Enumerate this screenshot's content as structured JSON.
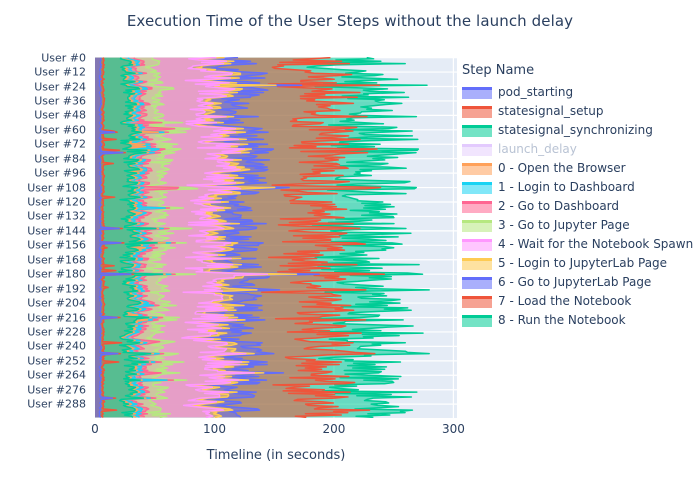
{
  "chart_data": {
    "type": "area",
    "title": "Execution Time of the User Steps without the launch delay",
    "xlabel": "Timeline (in seconds)",
    "ylabel": "",
    "xlim": [
      0,
      303
    ],
    "xticks": [
      0,
      100,
      200,
      300
    ],
    "xticklabels": [
      "0",
      "100",
      "200",
      "300"
    ],
    "grid": true,
    "orientation": "horizontal",
    "stacked": true,
    "legend_title": "Step Name",
    "legend_position": "right",
    "plot_bgcolor": "#e5ecf6",
    "paper_bgcolor": "#ffffff",
    "font_color": "#2a3f5f",
    "yticklabels": [
      "User #0",
      "User #12",
      "User #24",
      "User #36",
      "User #48",
      "User #60",
      "User #72",
      "User #84",
      "User #96",
      "User #108",
      "User #120",
      "User #132",
      "User #144",
      "User #156",
      "User #168",
      "User #180",
      "User #192",
      "User #204",
      "User #216",
      "User #228",
      "User #240",
      "User #252",
      "User #264",
      "User #276",
      "User #288"
    ],
    "ycategory_count": 300,
    "series": [
      {
        "name": "pod_starting",
        "line_color": "#636efa",
        "fill_color": "rgba(99,110,250,0.55)",
        "mean_value": 4.5,
        "visible": true
      },
      {
        "name": "statesignal_setup",
        "line_color": "#ef553b",
        "fill_color": "rgba(239,85,59,0.55)",
        "mean_value": 2.4,
        "visible": true
      },
      {
        "name": "statesignal_synchronizing",
        "line_color": "#00cc96",
        "fill_color": "rgba(0,204,150,0.55)",
        "mean_value": 22.0,
        "visible": true
      },
      {
        "name": "launch_delay",
        "line_color": "#ab63fa",
        "fill_color": "rgba(171,99,250,0.30)",
        "mean_value": 0,
        "visible": false
      },
      {
        "name": "0 - Open the Browser",
        "line_color": "#ffa15a",
        "fill_color": "rgba(255,161,90,0.55)",
        "mean_value": 2.1,
        "visible": true
      },
      {
        "name": "1 - Login to Dashboard",
        "line_color": "#19d3f3",
        "fill_color": "rgba(25,211,243,0.55)",
        "mean_value": 4.0,
        "visible": true
      },
      {
        "name": "2 - Go to Dashboard",
        "line_color": "#ff6692",
        "fill_color": "rgba(255,102,146,0.55)",
        "mean_value": 4.5,
        "visible": true
      },
      {
        "name": "3 - Go to Jupyter Page",
        "line_color": "#b6e880",
        "fill_color": "rgba(182,232,128,0.55)",
        "mean_value": 14.0,
        "visible": true
      },
      {
        "name": "4 - Wait for the Notebook Spawn",
        "line_color": "#ff97ff",
        "fill_color": "rgba(255,151,255,0.55)",
        "mean_value": 42.0,
        "visible": true
      },
      {
        "name": "5 - Login to JupyterLab Page",
        "line_color": "#fecb52",
        "fill_color": "rgba(254,203,82,0.55)",
        "mean_value": 7.0,
        "visible": true
      },
      {
        "name": "6 - Go to JupyterLab Page",
        "line_color": "#636efa",
        "fill_color": "rgba(99,110,250,0.55)",
        "mean_value": 18.0,
        "visible": true
      },
      {
        "name": "7 - Load the Notebook",
        "line_color": "#ef553b",
        "fill_color": "rgba(239,85,59,0.55)",
        "mean_value": 64.0,
        "visible": true
      },
      {
        "name": "8 - Run the Notebook",
        "line_color": "#00cc96",
        "fill_color": "rgba(0,204,150,0.55)",
        "mean_value": 40.0,
        "visible": true
      }
    ]
  },
  "legend": {
    "title": "Step Name",
    "items": [
      {
        "label": "pod_starting"
      },
      {
        "label": "statesignal_setup"
      },
      {
        "label": "statesignal_synchronizing"
      },
      {
        "label": "launch_delay"
      },
      {
        "label": "0 - Open the Browser"
      },
      {
        "label": "1 - Login to Dashboard"
      },
      {
        "label": "2 - Go to Dashboard"
      },
      {
        "label": "3 - Go to Jupyter Page"
      },
      {
        "label": "4 - Wait for the Notebook Spawn"
      },
      {
        "label": "5 - Login to JupyterLab Page"
      },
      {
        "label": "6 - Go to JupyterLab Page"
      },
      {
        "label": "7 - Load the Notebook"
      },
      {
        "label": "8 - Run the Notebook"
      }
    ]
  }
}
